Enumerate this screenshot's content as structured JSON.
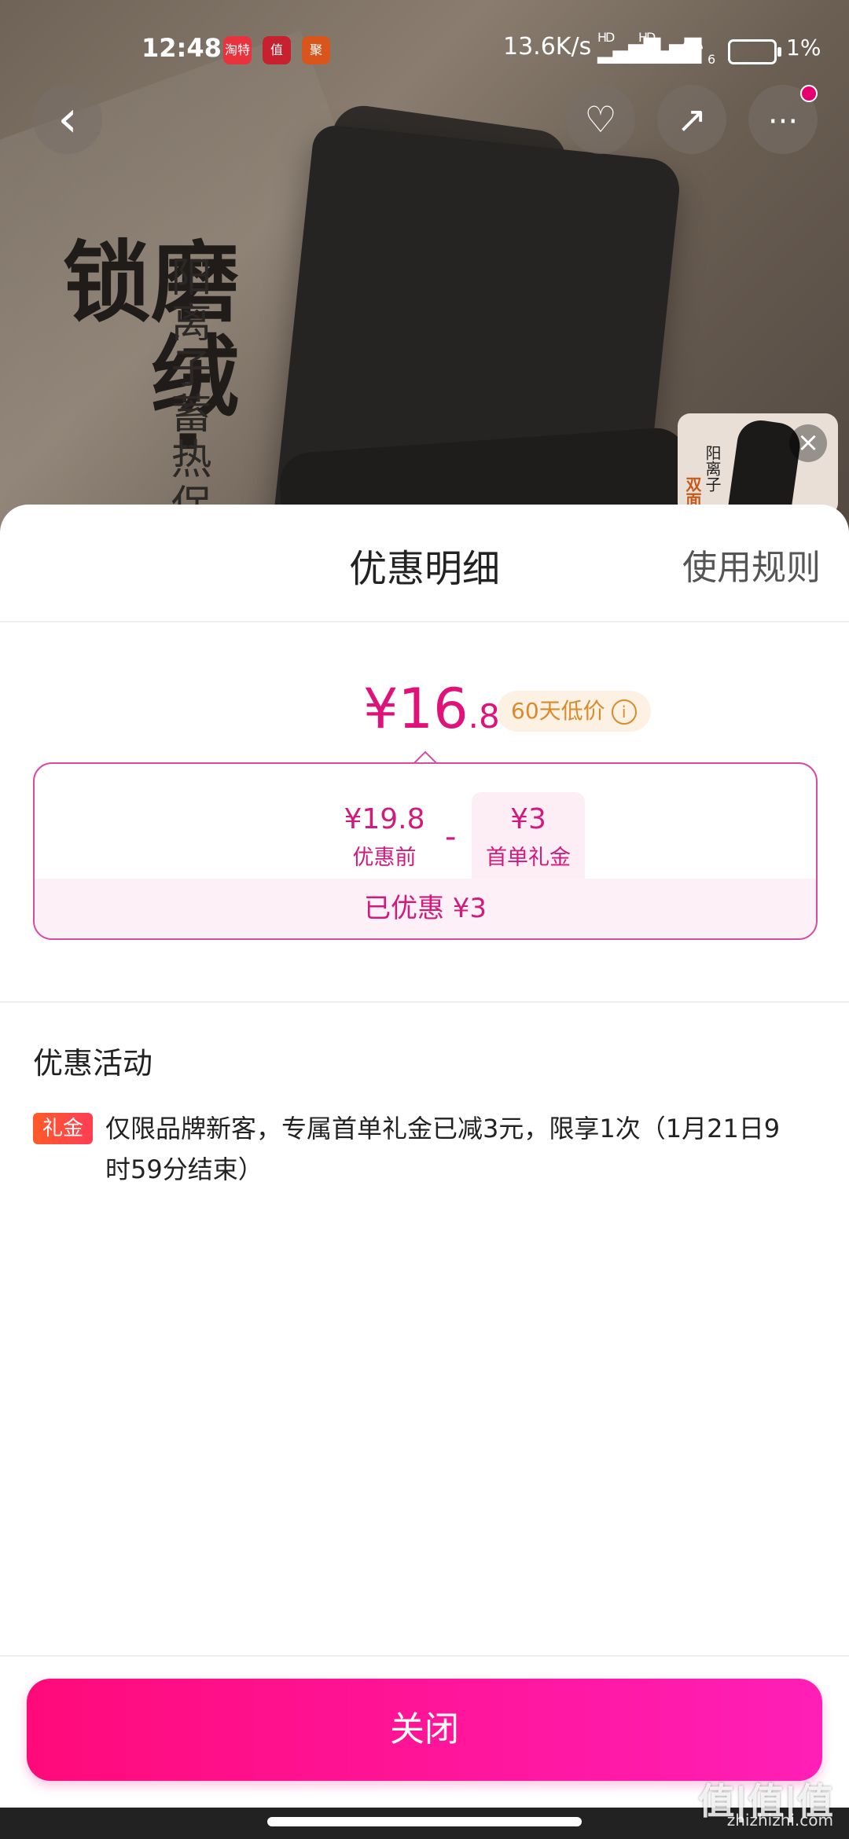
{
  "status_bar": {
    "time": "12:48",
    "app_icons": [
      "淘特",
      "值",
      "聚"
    ],
    "net_speed": "13.6K/s",
    "signal_1": "HD",
    "signal_2": "HD",
    "wifi_suffix": "6",
    "battery": "1%"
  },
  "hero": {
    "big_text": "磨绒·锁",
    "small_text": "阳离子蓄热保",
    "thumb_text_1": "阳离子",
    "thumb_text_2": "双面"
  },
  "top_buttons": {
    "back_icon": "‹",
    "favorite_icon": "♡",
    "share_icon": "↗",
    "more_icon": "···"
  },
  "sheet": {
    "title": "优惠明细",
    "rules_link": "使用规则",
    "price_symbol": "¥16",
    "price_decimal": ".8",
    "low_price_tag": "60天低价",
    "info_icon": "i",
    "original_price": "¥19.8",
    "original_label": "优惠前",
    "minus": "-",
    "coupon_value": "¥3",
    "coupon_label": "首单礼金",
    "saved_text": "已优惠 ¥3",
    "promo_section_title": "优惠活动",
    "promo_tag": "礼金",
    "promo_text": "仅限品牌新客，专属首单礼金已减3元，限享1次（1月21日9时59分结束）",
    "close_button": "关闭"
  },
  "watermark": {
    "brand": "值|值|值",
    "domain": "zhizhizhi.com"
  },
  "colors": {
    "accent_pink": "#e0127a",
    "button_gradient_start": "#ff0a7a",
    "button_gradient_end": "#ff1fb7",
    "tag_orange": "#ff5a2a"
  }
}
